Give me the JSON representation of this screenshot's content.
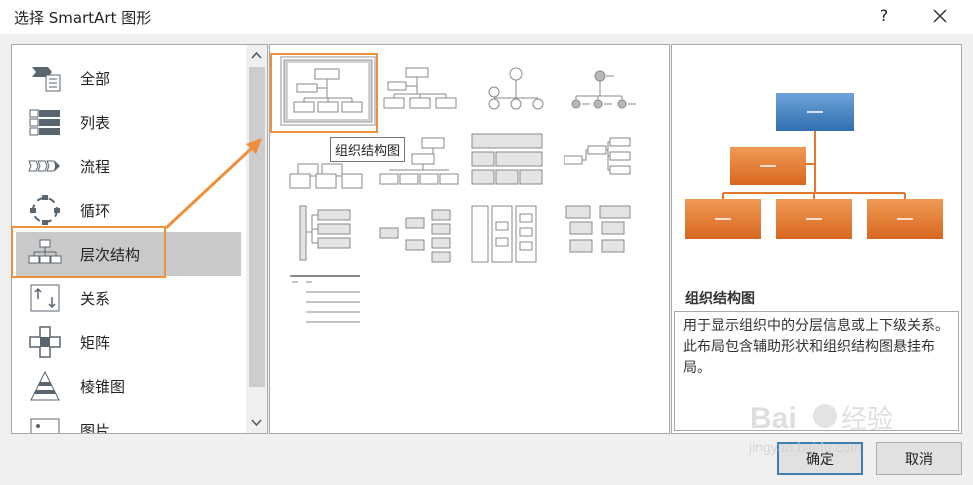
{
  "dialog": {
    "title": "选择 SmartArt 图形",
    "help_label": "?"
  },
  "categories": [
    {
      "label": "全部",
      "icon": "all-icon"
    },
    {
      "label": "列表",
      "icon": "list-icon"
    },
    {
      "label": "流程",
      "icon": "process-icon"
    },
    {
      "label": "循环",
      "icon": "cycle-icon"
    },
    {
      "label": "层次结构",
      "icon": "hierarchy-icon",
      "selected": true
    },
    {
      "label": "关系",
      "icon": "relationship-icon"
    },
    {
      "label": "矩阵",
      "icon": "matrix-icon"
    },
    {
      "label": "棱锥图",
      "icon": "pyramid-icon"
    },
    {
      "label": "图片",
      "icon": "picture-icon"
    }
  ],
  "gallery": {
    "tooltip": "组织结构图",
    "selected_index": 0
  },
  "preview": {
    "name": "组织结构图",
    "description": "用于显示组织中的分层信息或上下级关系。此布局包含辅助形状和组织结构图悬挂布局。"
  },
  "buttons": {
    "ok": "确定",
    "cancel": "取消"
  },
  "watermark": {
    "logo_text": "Baidu经验",
    "url": "jingyan.baidu.com"
  },
  "colors": {
    "annotation": "#ef8f3c",
    "preview_top": "#4a86c5",
    "preview_child": "#e8772e"
  }
}
